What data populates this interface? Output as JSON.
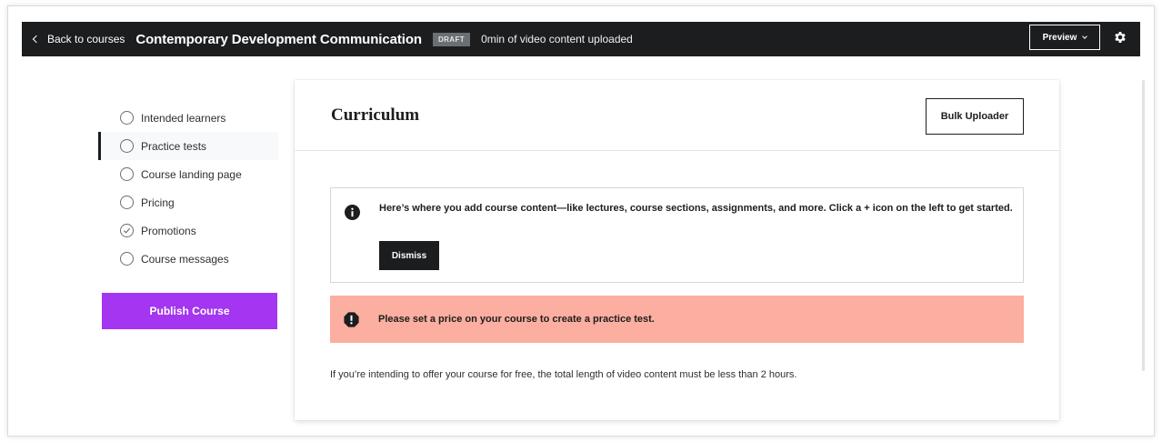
{
  "topbar": {
    "back_label": "Back to courses",
    "course_title": "Contemporary Development Communication",
    "status_badge": "DRAFT",
    "upload_status": "0min of video content uploaded",
    "preview_label": "Preview"
  },
  "sidebar": {
    "items": [
      {
        "label": "Intended learners",
        "checked": false,
        "active": false
      },
      {
        "label": "Practice tests",
        "checked": false,
        "active": true
      },
      {
        "label": "Course landing page",
        "checked": false,
        "active": false
      },
      {
        "label": "Pricing",
        "checked": false,
        "active": false
      },
      {
        "label": "Promotions",
        "checked": true,
        "active": false
      },
      {
        "label": "Course messages",
        "checked": false,
        "active": false
      }
    ],
    "publish_label": "Publish Course"
  },
  "main": {
    "title": "Curriculum",
    "bulk_uploader_label": "Bulk Uploader",
    "info": {
      "icon": "info-icon",
      "text": "Here’s where you add course content—like lectures, course sections, assignments, and more. Click a + icon on the left to get started.",
      "dismiss_label": "Dismiss"
    },
    "alert": {
      "icon": "alert-icon",
      "text": "Please set a price on your course to create a practice test."
    },
    "note": "If you’re intending to offer your course for free, the total length of video content must be less than 2 hours."
  },
  "colors": {
    "topbar_bg": "#1c1d1f",
    "publish_bg": "#a435f0",
    "alert_bg": "#fcaea0"
  }
}
